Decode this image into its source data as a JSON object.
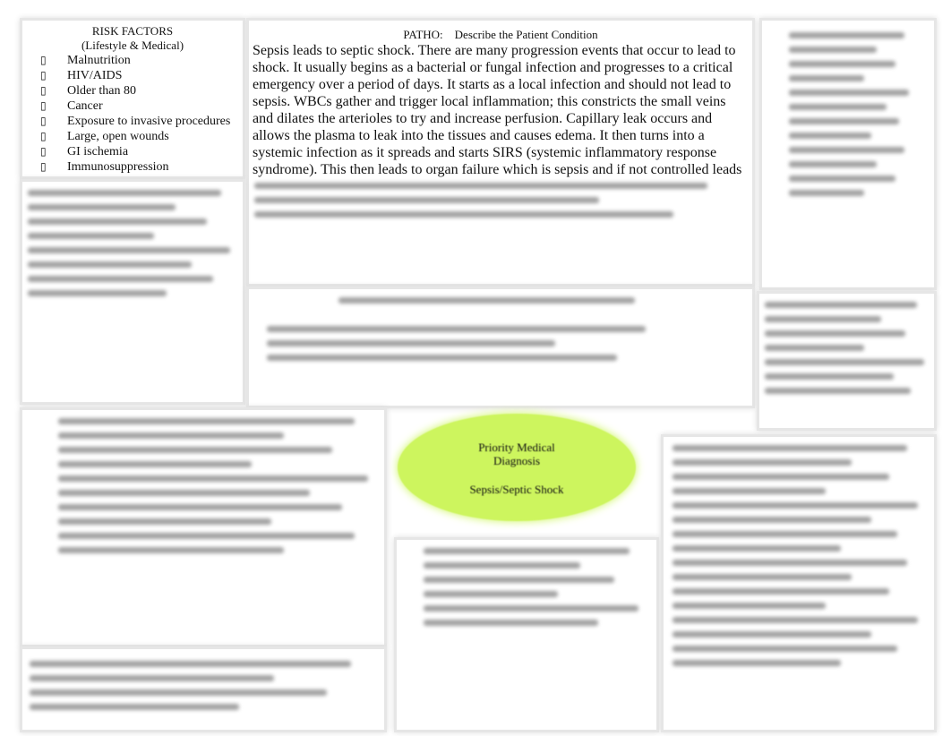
{
  "risk_factors": {
    "title": "RISK FACTORS",
    "subtitle": "(Lifestyle & Medical)",
    "bullet": "",
    "items": [
      "Malnutrition",
      "HIV/AIDS",
      "Older than 80",
      "Cancer",
      "Exposure to invasive procedures",
      "Large, open wounds",
      "GI ischemia",
      "Immunosuppression"
    ]
  },
  "patho": {
    "heading": "PATHO:    Describe the Patient Condition",
    "text": "Sepsis leads to septic shock. There are many progression events that occur to lead to shock. It usually begins as a bacterial or fungal infection and progresses to a critical emergency over a period of days. It starts as a local infection and should not lead to sepsis. WBCs gather and trigger local inflammation; this constricts the small veins and dilates the arterioles to try and increase perfusion. Capillary leak occurs and allows the plasma to leak into the tissues and causes edema. It then turns into a systemic infection as it spreads and starts SIRS (systemic inflammatory response syndrome). This then leads to organ failure which is sepsis and if not controlled leads to septic shock or"
  },
  "diagnosis": {
    "line1": "Priority Medical",
    "line2": "Diagnosis",
    "value": "Sepsis/Septic Shock",
    "color": "#cdf55e"
  }
}
